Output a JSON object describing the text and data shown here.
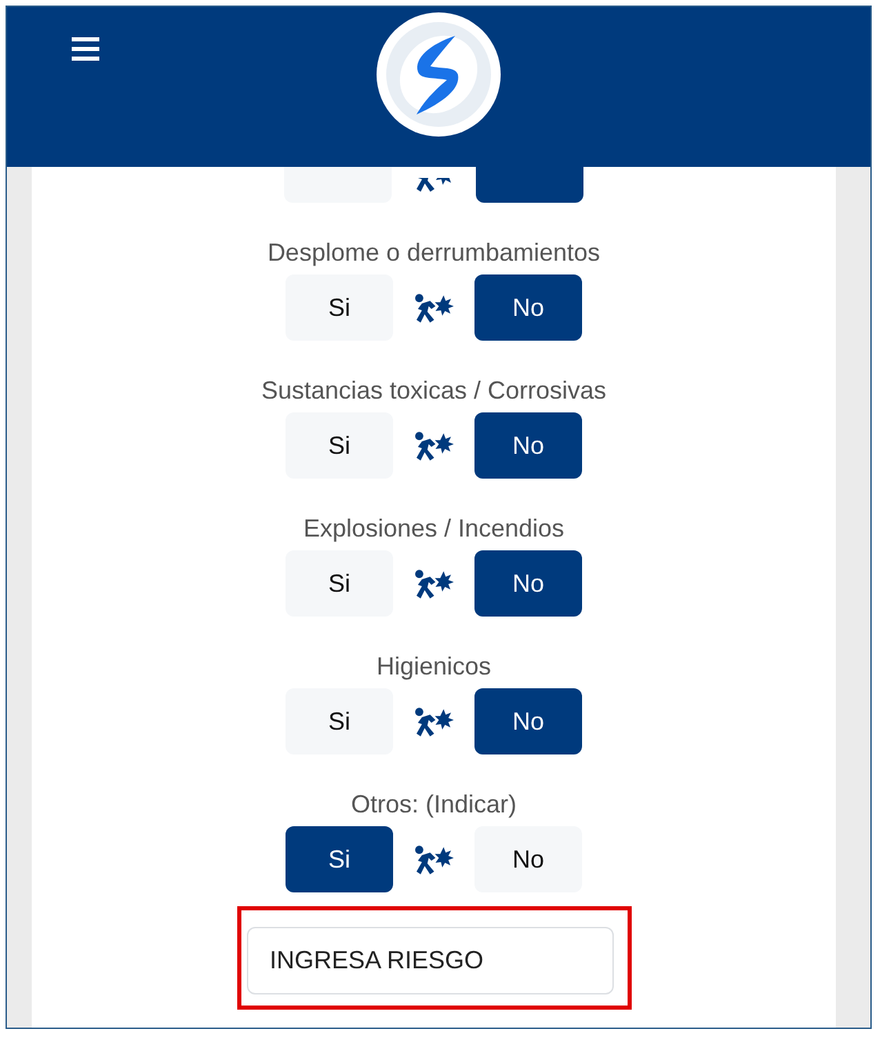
{
  "risks": [
    {
      "kind": "partial",
      "options": [
        {
          "selected": false
        },
        {
          "selected": true
        }
      ]
    },
    {
      "label": "Desplome o derrumbamientos",
      "options": [
        {
          "label": "Si",
          "selected": false
        },
        {
          "label": "No",
          "selected": true
        }
      ]
    },
    {
      "label": "Sustancias toxicas / Corrosivas",
      "options": [
        {
          "label": "Si",
          "selected": false
        },
        {
          "label": "No",
          "selected": true
        }
      ]
    },
    {
      "label": "Explosiones / Incendios",
      "options": [
        {
          "label": "Si",
          "selected": false
        },
        {
          "label": "No",
          "selected": true
        }
      ]
    },
    {
      "label": "Higienicos",
      "options": [
        {
          "label": "Si",
          "selected": false
        },
        {
          "label": "No",
          "selected": true
        }
      ]
    },
    {
      "label": "Otros: (Indicar)",
      "options": [
        {
          "label": "Si",
          "selected": true
        },
        {
          "label": "No",
          "selected": false
        }
      ]
    }
  ],
  "other_risk": {
    "value": "INGRESA RIESGO",
    "highlighted": true
  }
}
